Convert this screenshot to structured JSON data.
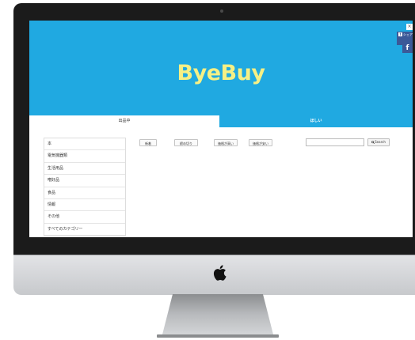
{
  "site": {
    "logo": "ByeBuy",
    "accent_color": "#20a9e1",
    "logo_color": "#f5f085"
  },
  "tabs": [
    {
      "label": "出品中",
      "active": true
    },
    {
      "label": "ほしい",
      "active": false
    }
  ],
  "categories": [
    "本",
    "電気機器類",
    "生活用品",
    "嗜好品",
    "食品",
    "情報",
    "その他",
    "すべてのカテゴリー"
  ],
  "sort_buttons": [
    "新着",
    "締め切り",
    "価格が高い",
    "価格が安い"
  ],
  "search": {
    "placeholder": "",
    "button_label": "Search",
    "button_icon": "search-icon"
  },
  "share": {
    "close_label": "×",
    "tab_label": "シェア",
    "facebook_icon": "facebook-icon",
    "facebook_glyph": "f"
  },
  "device": {
    "logo_icon": "apple-logo-icon"
  }
}
